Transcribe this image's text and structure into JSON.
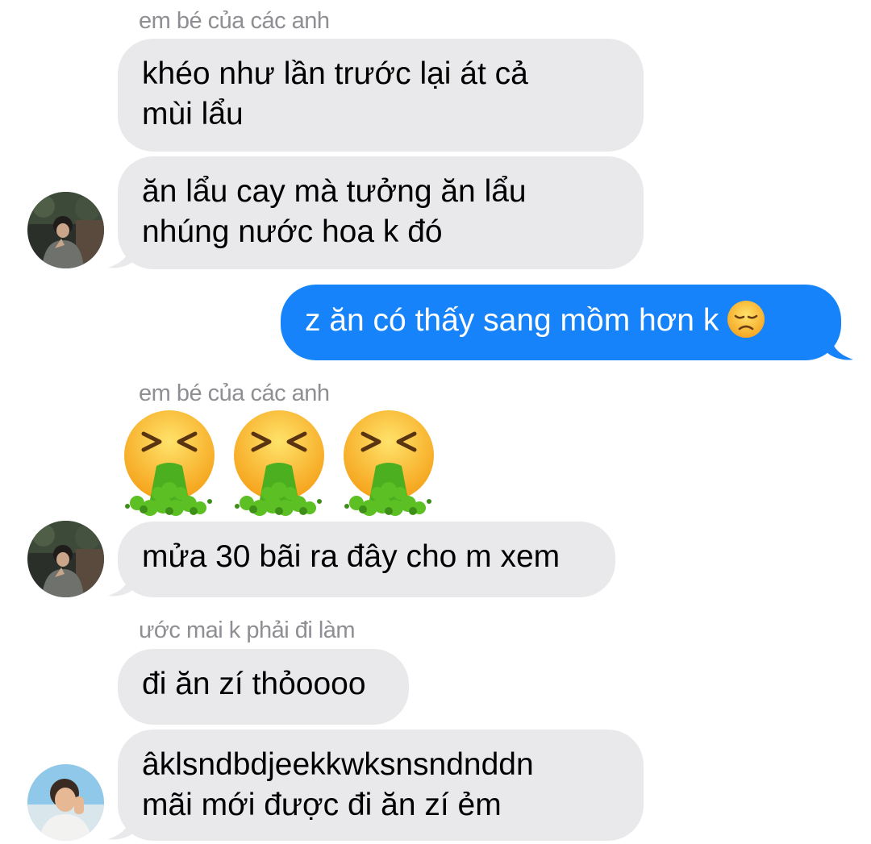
{
  "messages": [
    {
      "sender_name": "em bé của các anh",
      "bubbles": [
        "khéo như lần trước lại át cả\nmùi lẩu",
        "ăn lẩu cay mà tưởng ăn lẩu\nnhúng nước hoa k đó"
      ],
      "avatar": "avatar-photo-dark"
    },
    {
      "outgoing_text": "z ăn có thấy sang mồm hơn k",
      "outgoing_emoji": "disappointed-face-emoji"
    },
    {
      "sender_name": "em bé của các anh",
      "emoji_message": [
        "vomiting-face-emoji",
        "vomiting-face-emoji",
        "vomiting-face-emoji"
      ],
      "bubbles": [
        "mửa 30 bãi ra đây cho m xem"
      ],
      "avatar": "avatar-photo-dark"
    },
    {
      "sender_name": "ước mai k phải đi làm",
      "bubbles": [
        "đi ăn zí thỏoooo",
        "âklsndbdjeekkwksnsndnddn\nmãi mới được đi ăn zí ẻm"
      ],
      "avatar": "avatar-photo-light"
    }
  ],
  "colors": {
    "incoming_bubble": "#e9e9eb",
    "outgoing_bubble": "#1683fb",
    "sender_name": "#8e8e93"
  }
}
